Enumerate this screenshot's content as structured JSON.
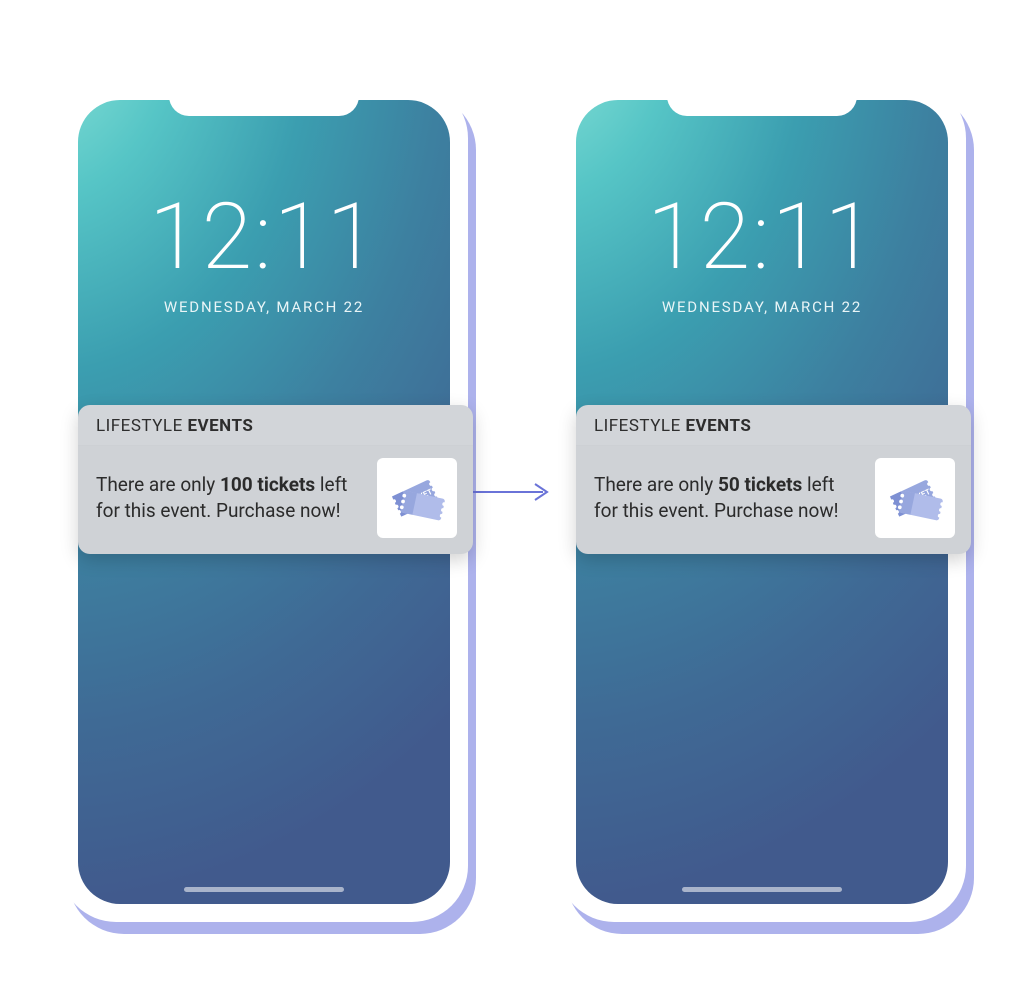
{
  "lockscreen": {
    "time": "12:11",
    "date": "WEDNESDAY, MARCH 22"
  },
  "notification": {
    "app_light": "LIFESTYLE ",
    "app_bold": "EVENTS",
    "icon": "ticket-icon"
  },
  "phones": [
    {
      "side": "left",
      "msg_pre": "There are only ",
      "msg_bold": "100 tickets",
      "msg_post": " left for this event. Purchase now!"
    },
    {
      "side": "right",
      "msg_pre": "There are only ",
      "msg_bold": "50 tickets",
      "msg_post": " left for this event. Purchase now!"
    }
  ],
  "colors": {
    "phone_shadow": "#6973dc",
    "screen_gradient_start": "#8fe6d9",
    "screen_gradient_end": "#415a8d",
    "notif_bg": "#cfd2d6",
    "ticket": "#8ea0dc"
  }
}
